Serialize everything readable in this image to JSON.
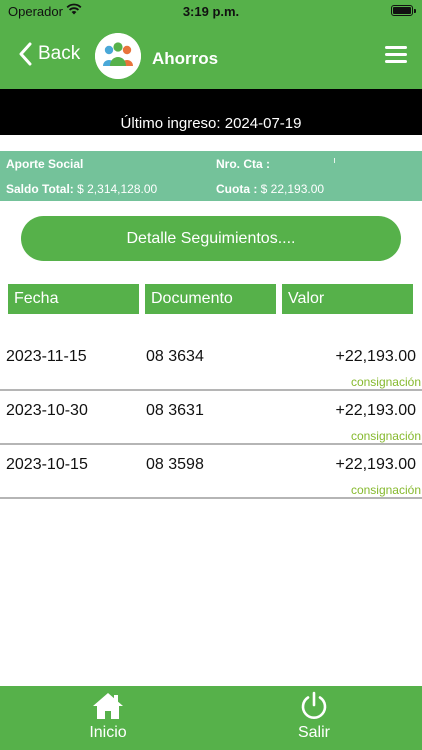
{
  "status_bar": {
    "carrier": "Operador",
    "time": "3:19 p.m."
  },
  "nav": {
    "back_label": "Back",
    "title": "Ahorros"
  },
  "last_login": "Último ingreso: 2024-07-19",
  "account": {
    "aporte_label": "Aporte Social",
    "cuenta_label": "Nro. Cta :",
    "cuenta_value": "",
    "saldo_label": "Saldo Total:",
    "saldo_value": "$ 2,314,128.00",
    "cuota_label": "Cuota :",
    "cuota_value": "$ 22,193.00"
  },
  "detail_button": "Detalle Seguimientos....",
  "columns": [
    "Fecha",
    "Documento",
    "Valor"
  ],
  "rows": [
    {
      "date": "2023-11-15",
      "document": "08 3634",
      "value": "+22,193.00",
      "type": "consignación"
    },
    {
      "date": "2023-10-30",
      "document": "08 3631",
      "value": "+22,193.00",
      "type": "consignación"
    },
    {
      "date": "2023-10-15",
      "document": "08 3598",
      "value": "+22,193.00",
      "type": "consignación"
    }
  ],
  "tabs": {
    "home_label": "Inicio",
    "exit_label": "Salir"
  },
  "colors": {
    "primary_green": "#56b14a",
    "panel_green": "#74c29a",
    "type_text": "#86b92e",
    "black_bar": "#000000"
  },
  "icons": {
    "home": "home-icon",
    "power": "power-icon",
    "menu": "menu-icon",
    "back": "chevron-left-icon",
    "logo": "people-logo"
  }
}
